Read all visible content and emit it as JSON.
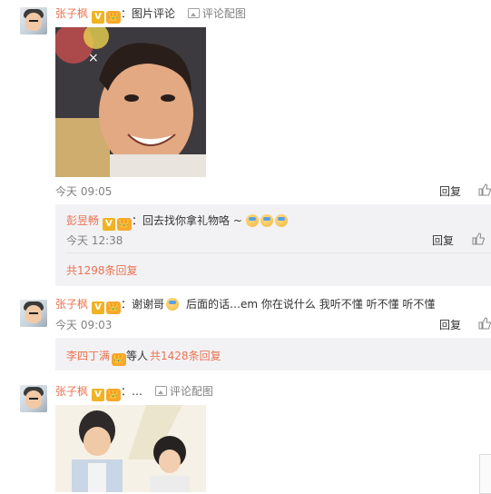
{
  "comment1": {
    "author": "张子枫",
    "v_badge": "V",
    "crown_badge": "👑",
    "text": "图片评论",
    "pic_link": "评论配图",
    "time": "今天 09:05",
    "reply_label": "回复"
  },
  "reply1": {
    "author": "彭昱畅",
    "v_badge": "V",
    "crown_badge": "👑",
    "text": "回去找你拿礼物咯 ~",
    "time": "今天 12:38",
    "reply_label": "回复",
    "more": "共1298条回复"
  },
  "comment2": {
    "author": "张子枫",
    "v_badge": "V",
    "crown_badge": "👑",
    "text_a": "谢谢哥",
    "text_b": "后面的话…em 你在说什么 我听不懂 听不懂 听不懂",
    "time": "今天 09:03",
    "reply_label": "回复"
  },
  "reply2": {
    "author": "李四丁满",
    "crown_badge": "👑",
    "others": "等人",
    "more": "共1428条回复"
  },
  "comment3": {
    "author": "张子枫",
    "v_badge": "V",
    "crown_badge": "👑",
    "text": "…",
    "pic_link": "评论配图"
  },
  "colors": {
    "name": "#eb7350",
    "time": "#808080",
    "thread_bg": "#f2f2f5",
    "v_badge": "#f0b323"
  },
  "icons": [
    "avatar",
    "v-badge",
    "crown-badge",
    "picture-icon",
    "like-icon",
    "emoji-face",
    "close-icon"
  ]
}
